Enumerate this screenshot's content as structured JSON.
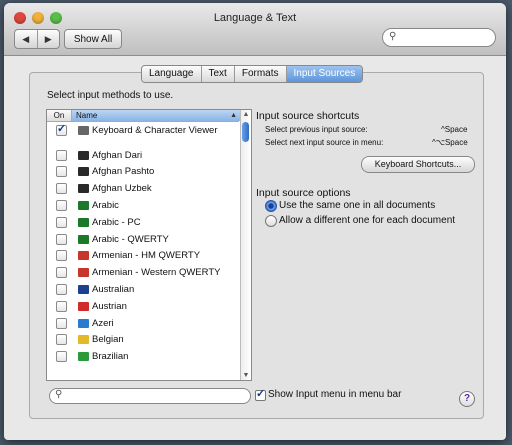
{
  "window": {
    "title": "Language & Text"
  },
  "toolbar": {
    "back_icon": "◀",
    "forward_icon": "▶",
    "show_all_label": "Show All",
    "search_value": ""
  },
  "tabs": [
    {
      "label": "Language",
      "selected": false
    },
    {
      "label": "Text",
      "selected": false
    },
    {
      "label": "Formats",
      "selected": false
    },
    {
      "label": "Input Sources",
      "selected": true
    }
  ],
  "input_sources": {
    "instruction": "Select input methods to use.",
    "columns": {
      "on": "On",
      "name": "Name"
    },
    "items": [
      {
        "name": "Keyboard & Character Viewer",
        "checked": true,
        "icon": "keyboard-viewer-icon",
        "color": "#666666"
      },
      {
        "name": "Afghan Dari",
        "checked": false,
        "icon": "flag-afghanistan-icon",
        "color": "#2a2a2a"
      },
      {
        "name": "Afghan Pashto",
        "checked": false,
        "icon": "flag-afghanistan-icon",
        "color": "#2a2a2a"
      },
      {
        "name": "Afghan Uzbek",
        "checked": false,
        "icon": "flag-afghanistan-icon",
        "color": "#2a2a2a"
      },
      {
        "name": "Arabic",
        "checked": false,
        "icon": "crescent-icon",
        "color": "#1a7a2a"
      },
      {
        "name": "Arabic - PC",
        "checked": false,
        "icon": "crescent-icon",
        "color": "#1a7a2a"
      },
      {
        "name": "Arabic - QWERTY",
        "checked": false,
        "icon": "crescent-icon",
        "color": "#1a7a2a"
      },
      {
        "name": "Armenian - HM QWERTY",
        "checked": false,
        "icon": "flag-armenia-icon",
        "color": "#c6362a"
      },
      {
        "name": "Armenian - Western QWERTY",
        "checked": false,
        "icon": "flag-armenia-icon",
        "color": "#c6362a"
      },
      {
        "name": "Australian",
        "checked": false,
        "icon": "flag-australia-icon",
        "color": "#1f3f8f"
      },
      {
        "name": "Austrian",
        "checked": false,
        "icon": "flag-austria-icon",
        "color": "#d02a2a"
      },
      {
        "name": "Azeri",
        "checked": false,
        "icon": "flag-azerbaijan-icon",
        "color": "#2a7ad0"
      },
      {
        "name": "Belgian",
        "checked": false,
        "icon": "flag-belgium-icon",
        "color": "#e3b82a"
      },
      {
        "name": "Brazilian",
        "checked": false,
        "icon": "flag-brazil-icon",
        "color": "#2a9a3a"
      }
    ]
  },
  "shortcuts": {
    "heading": "Input source shortcuts",
    "previous_label": "Select previous input source:",
    "previous_key": "^Space",
    "next_label": "Select next input source in menu:",
    "next_key": "^⌥Space",
    "button_label": "Keyboard Shortcuts..."
  },
  "options": {
    "heading": "Input source options",
    "choices": [
      {
        "label": "Use the same one in all documents",
        "selected": true
      },
      {
        "label": "Allow a different one for each document",
        "selected": false
      }
    ]
  },
  "bottom": {
    "search_value": "",
    "show_menu_label": "Show Input menu in menu bar",
    "show_menu_checked": true,
    "help_label": "?"
  }
}
